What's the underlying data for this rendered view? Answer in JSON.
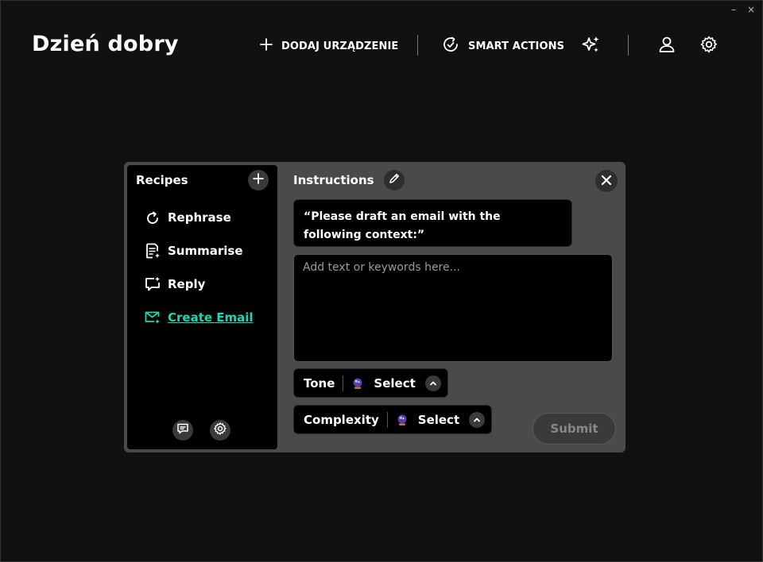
{
  "window": {
    "minimize_label": "–",
    "close_label": "×"
  },
  "header": {
    "greeting": "Dzień dobry",
    "add_device_label": "DODAJ URZĄDZENIE",
    "smart_actions_label": "SMART ACTIONS",
    "icons": [
      "plus-icon",
      "smart-actions-icon",
      "sparkles-icon",
      "user-icon",
      "gear-icon"
    ]
  },
  "recipes": {
    "title": "Recipes",
    "items": [
      {
        "label": "Rephrase",
        "icon": "rephrase-icon",
        "active": false
      },
      {
        "label": "Summarise",
        "icon": "summarise-icon",
        "active": false
      },
      {
        "label": "Reply",
        "icon": "reply-icon",
        "active": false
      },
      {
        "label": "Create Email",
        "icon": "create-email-icon",
        "active": true
      }
    ],
    "footer_icons": [
      "feedback-icon",
      "gear-icon"
    ]
  },
  "instructions": {
    "title": "Instructions",
    "prompt": "“Please draft an email with the following context:”",
    "input_placeholder": "Add text or keywords here...",
    "input_value": "",
    "tone": {
      "label": "Tone",
      "value": "Select"
    },
    "complexity": {
      "label": "Complexity",
      "value": "Select"
    },
    "submit_label": "Submit"
  },
  "colors": {
    "background": "#111111",
    "dialog": "#4a4a4a",
    "panel": "#000000",
    "accent": "#1ed6b2",
    "disabled_text": "#888888"
  }
}
